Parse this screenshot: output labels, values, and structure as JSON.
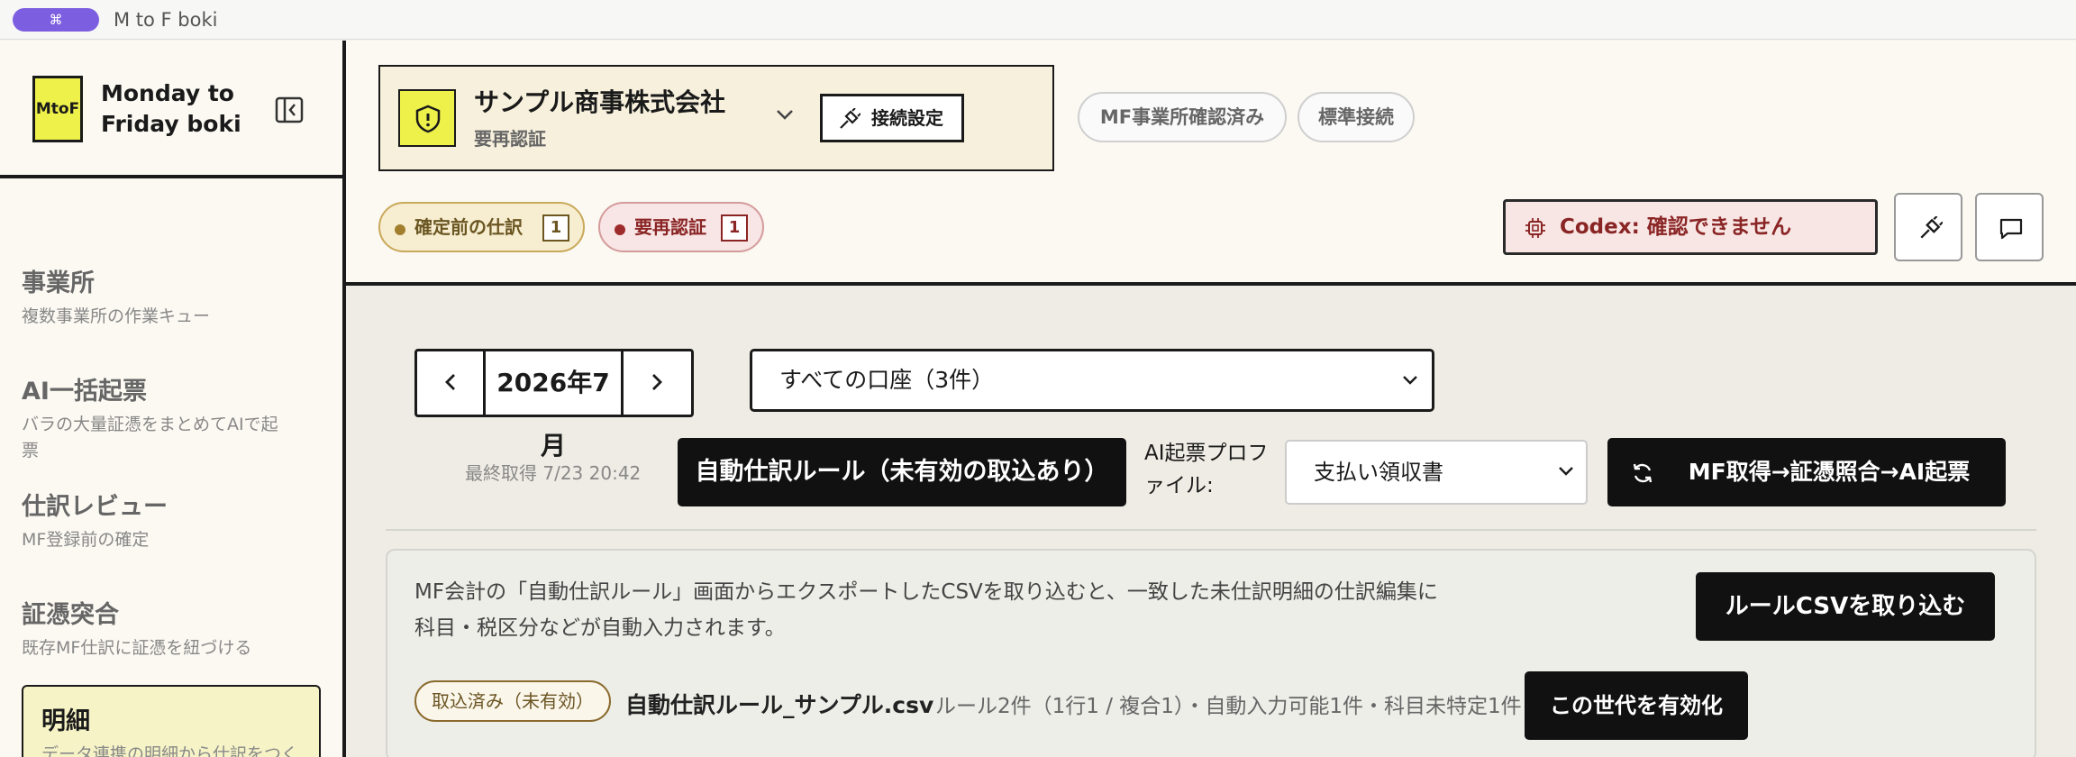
{
  "window": {
    "shortcut": "⌘",
    "title": "M to F boki"
  },
  "brand": {
    "logo_text": "MtoF",
    "name": "Monday to Friday boki"
  },
  "nav": [
    {
      "title": "事業所",
      "sub": "複数事業所の作業キュー"
    },
    {
      "title": "AI一括起票",
      "sub": "バラの大量証憑をまとめてAIで起票"
    },
    {
      "title": "仕訳レビュー",
      "sub": "MF登録前の確定"
    },
    {
      "title": "証憑突合",
      "sub": "既存MF仕訳に証憑を紐づける"
    },
    {
      "title": "明細",
      "sub": "データ連携の明細から仕訳をつくる"
    }
  ],
  "company": {
    "name": "サンプル商事株式会社",
    "status": "要再認証",
    "connection_button": "接続設定"
  },
  "tags": {
    "verified": "MF事業所確認済み",
    "standard": "標準接続"
  },
  "badges": {
    "pending": {
      "label": "確定前の仕訳",
      "count": "1"
    },
    "reauth": {
      "label": "要再認証",
      "count": "1"
    }
  },
  "codex_status": "Codex: 確認できません",
  "period": {
    "month": "2026年7月"
  },
  "account_filter": {
    "selected": "すべての口座（3件）"
  },
  "last_fetch": "最終取得 7/23 20:42",
  "auto_rule_button": "自動仕訳ルール（未有効の取込あり）",
  "ai_profile": {
    "label": "AI起票プロファイル:",
    "selected": "支払い領収書"
  },
  "run_button": "MF取得→証憑照合→AI起票",
  "rules_info": {
    "description": "MF会計の「自動仕訳ルール」画面からエクスポートしたCSVを取り込むと、一致した未仕訳明細の仕訳編集に科目・税区分などが自動入力されます。",
    "import_button": "ルールCSVを取り込む",
    "status": "取込済み（未有効）",
    "file_name": "自動仕訳ルール_サンプル.csv",
    "summary": "ルール2件（1行1 / 複合1）・自動入力可能1件・科目未特定1件",
    "activate_button": "この世代を有効化"
  },
  "colors": {
    "accent_yellow": "#eef14a",
    "dark": "#111111",
    "alert_red": "#8a2525",
    "pill_purple": "#7c5fe0"
  }
}
